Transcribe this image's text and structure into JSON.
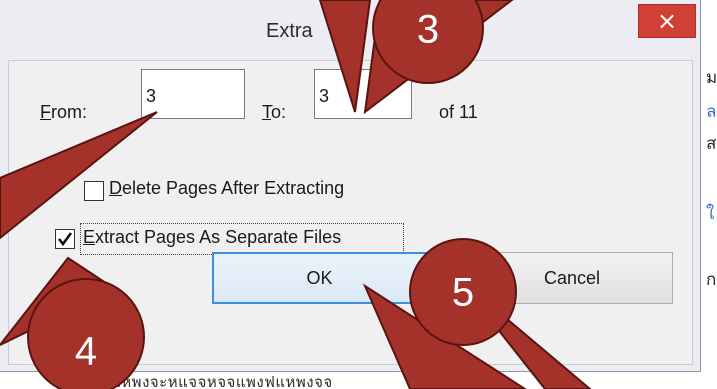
{
  "dialog": {
    "title": "Extra",
    "close_symbol": "×"
  },
  "from": {
    "label_accel": "F",
    "label_rest": "rom:",
    "value": "3"
  },
  "to": {
    "label_accel": "T",
    "label_rest": "o:",
    "value": "3"
  },
  "of_text": "of 11",
  "options": {
    "delete_pages": {
      "accel": "D",
      "rest": "elete Pages After Extracting",
      "checked": false
    },
    "separate_files": {
      "accel": "E",
      "rest": "xtract Pages As Separate Files",
      "checked": true
    }
  },
  "buttons": {
    "ok": "OK",
    "cancel": "Cancel"
  },
  "callouts": [
    "3",
    "4",
    "5"
  ],
  "background": {
    "bottom_text": "ฟแหพงจะหแจจหจจแพงฟแหพงจจ",
    "right_glyphs": [
      "ม",
      "ล",
      "ส",
      "ใ",
      "ก"
    ]
  },
  "colors": {
    "callout_fill": "#a4322b",
    "callout_stroke": "#5a1410",
    "close_button": "#d04035",
    "default_button_border": "#3c8fd8"
  }
}
